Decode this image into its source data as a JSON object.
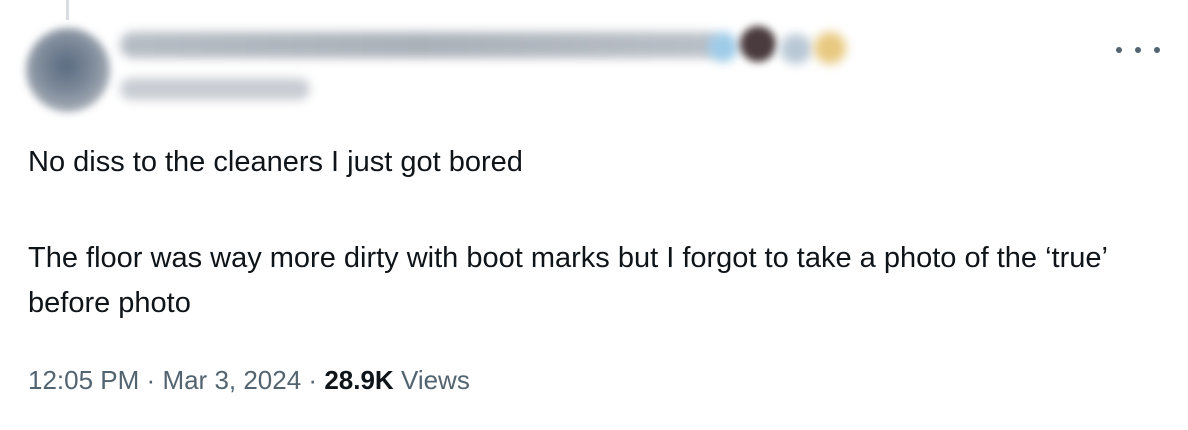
{
  "tweet": {
    "author": {
      "display_name": "",
      "handle": "",
      "avatar_icon": "avatar-blurred"
    },
    "more_icon": "more-horizontal-icon",
    "paragraphs": [
      "No diss to the cleaners I just got bored",
      "The floor was way more dirty with boot marks but I forgot to take a photo of the ‘true’ before photo"
    ],
    "time": "12:05 PM",
    "separator": "·",
    "date": "Mar 3, 2024",
    "views_count": "28.9K",
    "views_label": "Views"
  },
  "colors": {
    "text": "#0f1419",
    "secondary": "#536471",
    "thread_line": "#d9dde1"
  }
}
